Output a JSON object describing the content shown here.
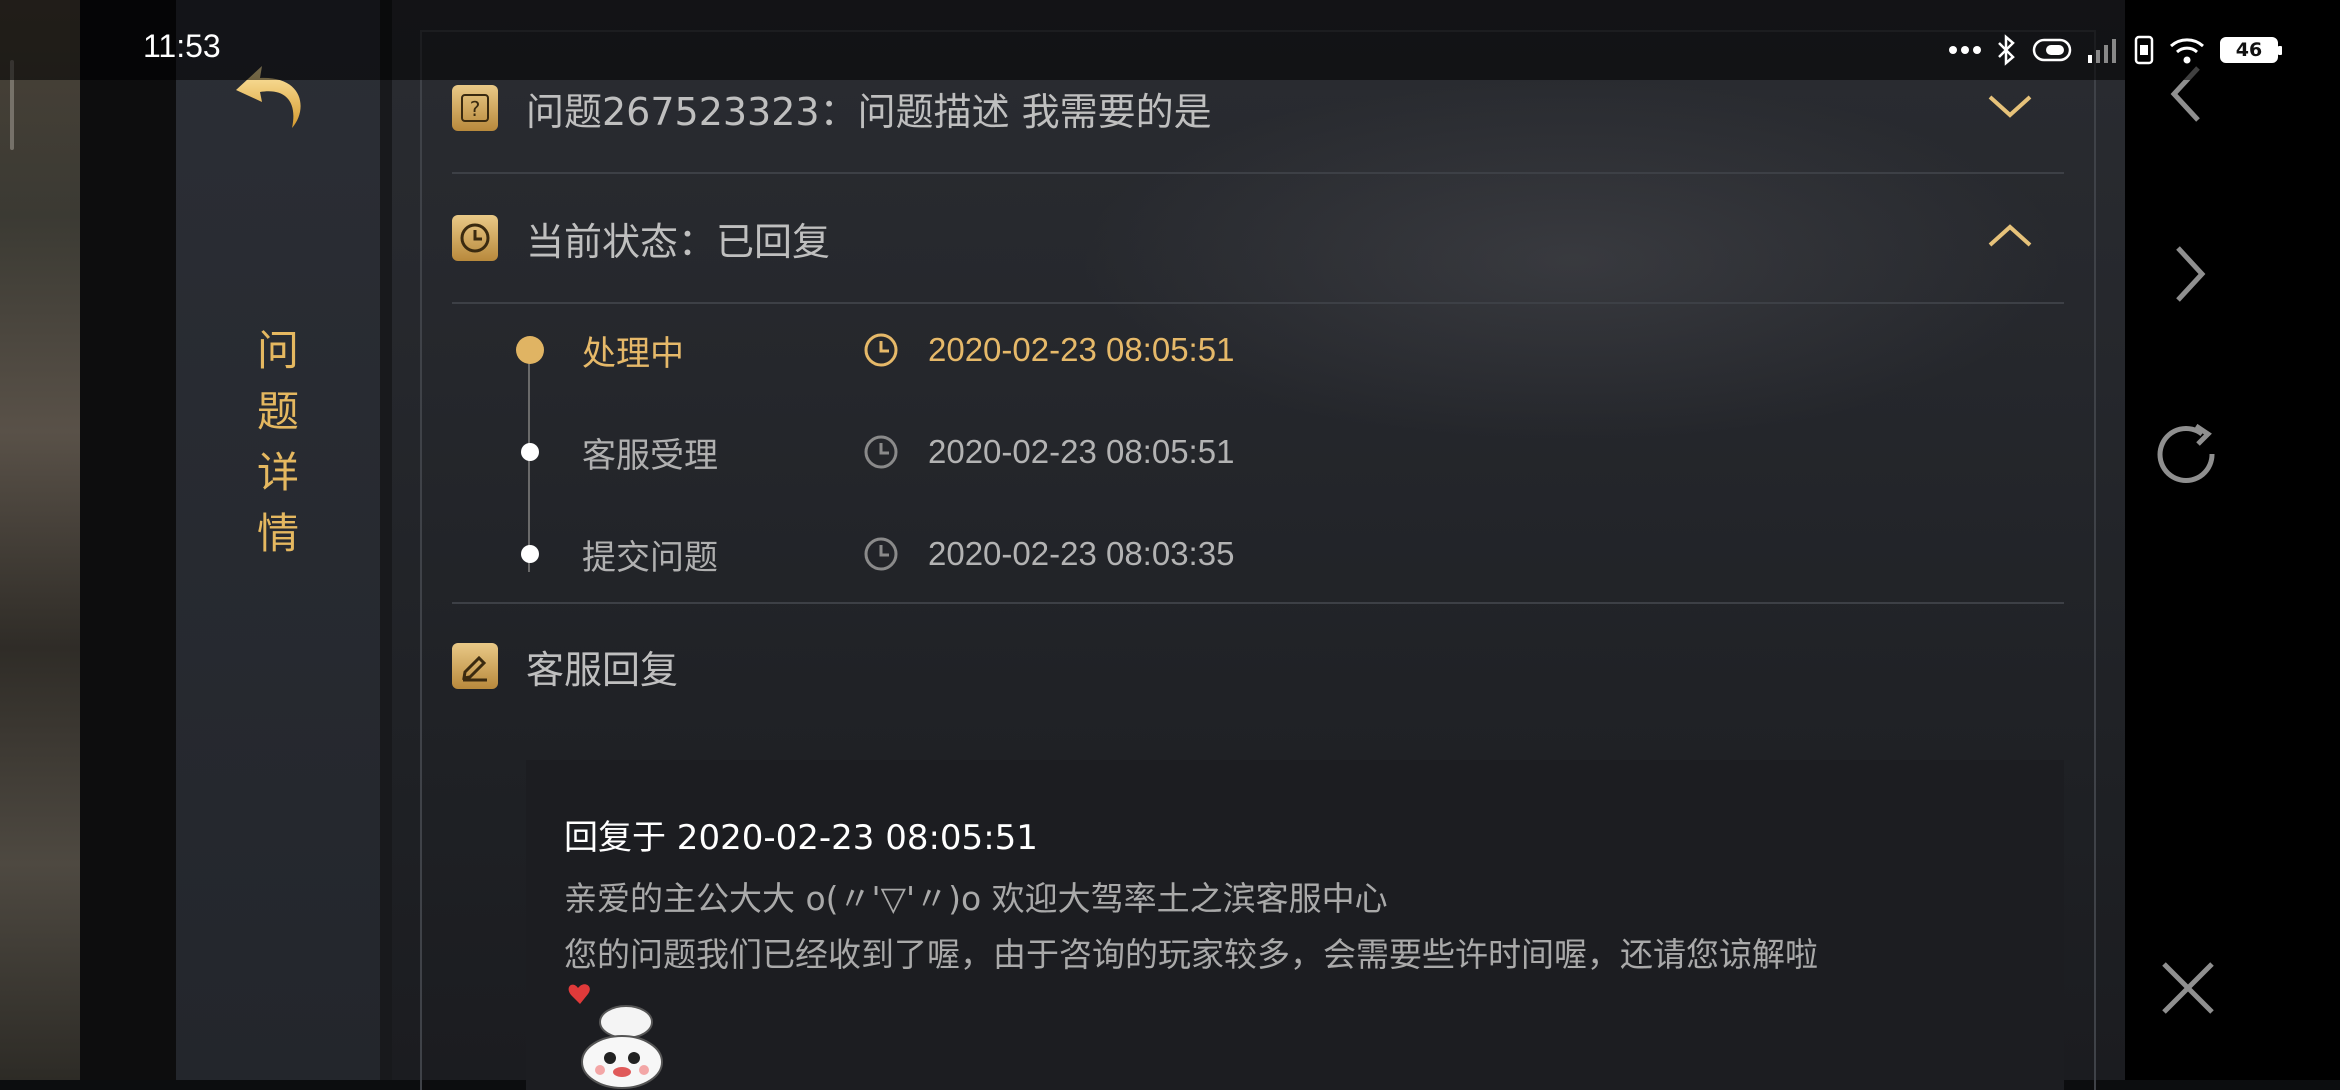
{
  "status_bar": {
    "time": "11:53",
    "battery": "46",
    "icons": [
      "more-dots-icon",
      "bluetooth-icon",
      "battery-saver-icon",
      "signal-icon",
      "sim-icon",
      "wifi-icon",
      "battery-icon"
    ]
  },
  "sidebar": {
    "title_chars": [
      "问",
      "题",
      "详",
      "情"
    ],
    "back_icon": "back-arrow-icon"
  },
  "question": {
    "text": "问题267523323：问题描述 我需要的是"
  },
  "status": {
    "text": "当前状态：已回复"
  },
  "timeline": [
    {
      "label": "处理中",
      "time": "2020-02-23 08:05:51",
      "active": true
    },
    {
      "label": "客服受理",
      "time": "2020-02-23 08:05:51",
      "active": false
    },
    {
      "label": "提交问题",
      "time": "2020-02-23 08:03:35",
      "active": false
    }
  ],
  "reply_section": {
    "title": "客服回复",
    "header": "回复于 2020-02-23 08:05:51",
    "line1": "亲爱的主公大大 o(〃'▽'〃)o 欢迎大驾率土之滨客服中心",
    "line2": "您的问题我们已经收到了喔，由于咨询的玩家较多，会需要些许时间喔，还请您谅解啦",
    "sticker": "chef-mascot-sticker"
  },
  "right_nav": [
    "back-nav-icon",
    "forward-nav-icon",
    "refresh-icon",
    "close-icon"
  ],
  "colors": {
    "accent_gold": "#e6b969",
    "panel_bg": "#25272c",
    "text_gray": "#bfbfbf"
  }
}
